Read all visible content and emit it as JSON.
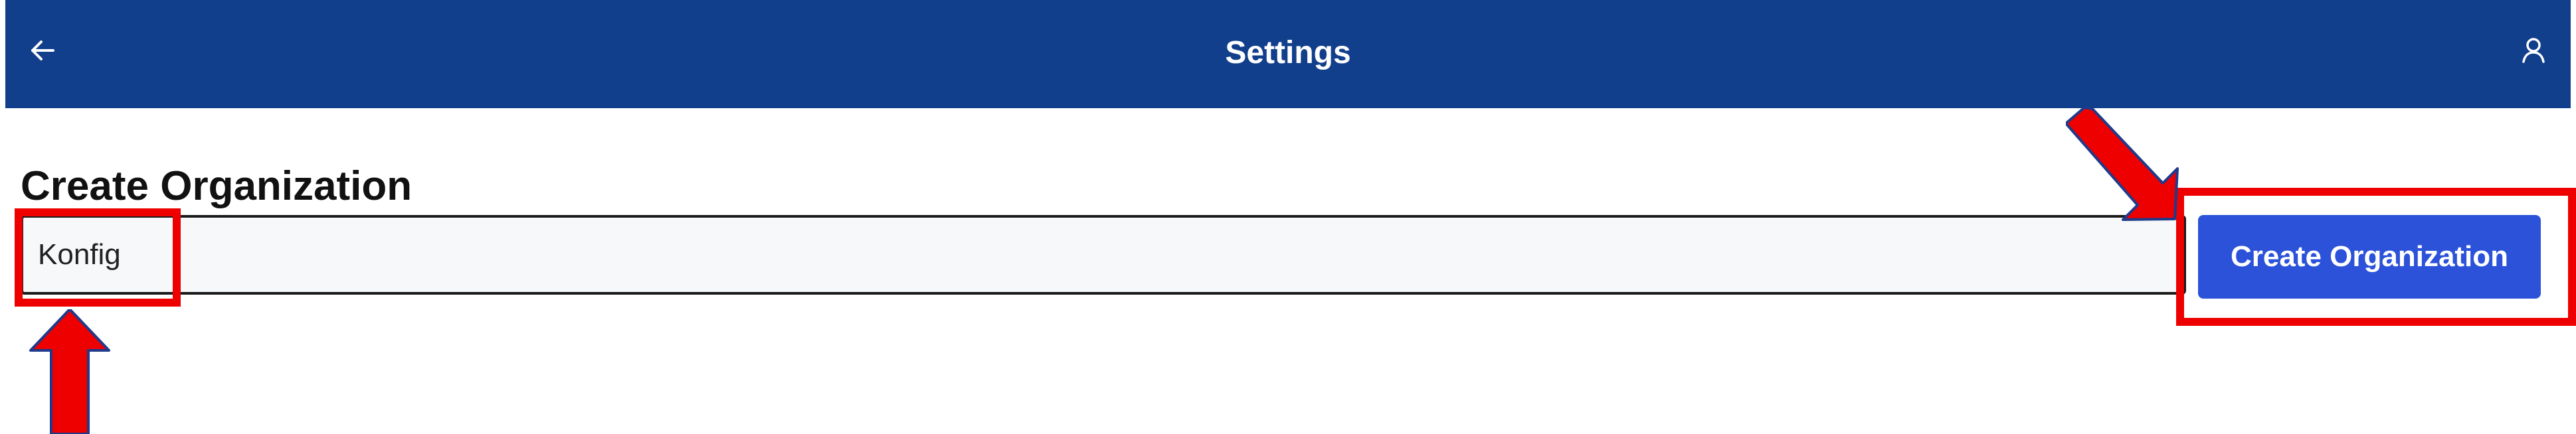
{
  "header": {
    "title": "Settings",
    "back_icon": "arrow-left-icon",
    "profile_icon": "user-icon",
    "background_color": "#123f8c"
  },
  "section": {
    "title": "Create Organization"
  },
  "form": {
    "organization_name_value": "Konfig",
    "create_button_label": "Create Organization",
    "button_color": "#2b52d9"
  },
  "annotations": {
    "highlight_color": "#ee0000",
    "arrow_color": "#ee0000",
    "arrow_outline_color": "#1f3a8a"
  }
}
